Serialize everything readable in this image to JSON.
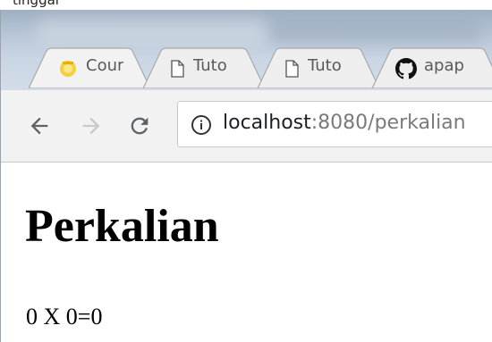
{
  "caption": {
    "text": "tinggal "
  },
  "tabs": [
    {
      "label": "Cour",
      "icon": "course-favicon-icon"
    },
    {
      "label": "Tuto",
      "icon": "document-icon"
    },
    {
      "label": "Tuto",
      "icon": "document-icon"
    },
    {
      "label": "apap",
      "icon": "github-icon"
    }
  ],
  "toolbar": {
    "back_icon": "arrow-left-icon",
    "forward_icon": "arrow-right-icon",
    "reload_icon": "reload-icon",
    "info_icon": "info-icon",
    "url_host": "localhost",
    "url_path": ":8080/perkalian"
  },
  "page": {
    "heading": "Perkalian",
    "result": "0 X 0=0"
  },
  "colors": {
    "tab_bg": "#f2f2f2",
    "tab_border": "#a9a9a9",
    "toolbar_bg": "#f2f2f2",
    "icon_active": "#5f6368",
    "icon_disabled": "#c9c9c9"
  }
}
